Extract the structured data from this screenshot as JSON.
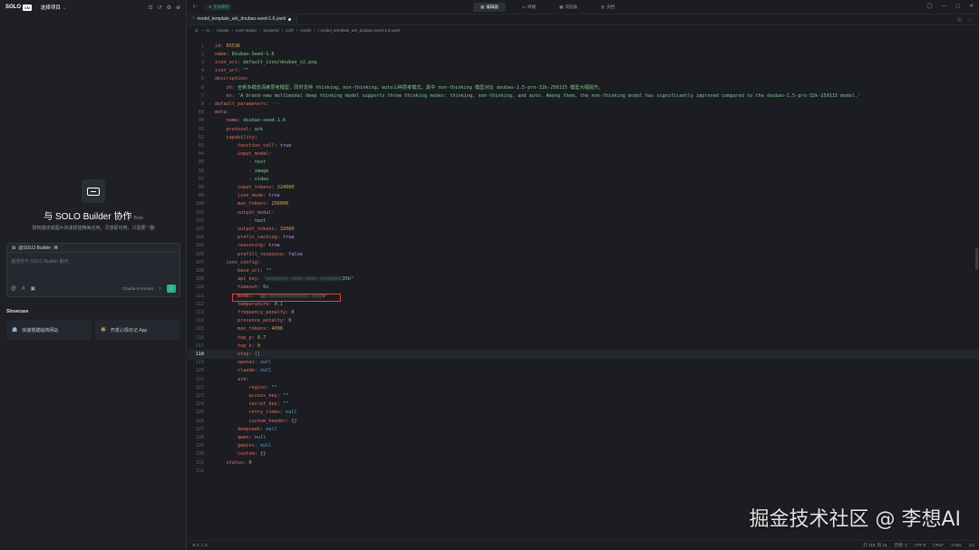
{
  "left_panel": {
    "brand": "SOLO",
    "brand_box": "CN",
    "project_label": "选择项目",
    "hero_title": "与 SOLO Builder 协作",
    "hero_badge": "Beta",
    "hero_subtitle": "按转描述或图片快速搭建精美应用，灵感即可用，只需要一翻",
    "chat_mention": "@SOLO Builder",
    "chat_placeholder": "描述你与 SOLO Builder 聊天",
    "chat_model": "Claude-4-Sonnet",
    "showcase_title": "Showcase",
    "showcase": [
      {
        "label": "快速搭建临商网站"
      },
      {
        "label": "开发心情日记 App"
      }
    ]
  },
  "title_bar": {
    "chip": "灵动模组",
    "tabs": [
      {
        "label": "编辑器",
        "active": true
      },
      {
        "label": "终端",
        "active": false
      },
      {
        "label": "浏览器",
        "active": false
      },
      {
        "label": "文档",
        "active": false
      }
    ]
  },
  "file_tab": {
    "name": "model_template_ark_doubao-seed-1.6.yaml"
  },
  "breadcrumb": [
    "D:",
    "AI",
    "Aicode",
    "coze-studio",
    "backend",
    "conf",
    "model",
    "! model_template_ark_doubao-seed-1.6.yaml"
  ],
  "code_lines": [
    {
      "n": "1",
      "i": 0,
      "parts": [
        [
          "k",
          "id"
        ],
        [
          "p",
          ": "
        ],
        [
          "n",
          "65536"
        ]
      ]
    },
    {
      "n": "2",
      "i": 0,
      "parts": [
        [
          "k",
          "name"
        ],
        [
          "p",
          ": "
        ],
        [
          "s",
          "Doubao-Seed-1.6"
        ]
      ]
    },
    {
      "n": "3",
      "i": 0,
      "parts": [
        [
          "k",
          "icon_uri"
        ],
        [
          "p",
          ": "
        ],
        [
          "s",
          "default_icon/doubao_v2.png"
        ]
      ]
    },
    {
      "n": "4",
      "i": 0,
      "parts": [
        [
          "k",
          "icon_url"
        ],
        [
          "p",
          ": "
        ],
        [
          "s",
          "\"\""
        ]
      ]
    },
    {
      "n": "5",
      "i": 0,
      "parts": [
        [
          "k",
          "description"
        ],
        [
          "p",
          ":"
        ]
      ]
    },
    {
      "n": "6",
      "i": 1,
      "parts": [
        [
          "k",
          "zh"
        ],
        [
          "p",
          ": "
        ],
        [
          "s",
          "全新多模态深度思考模型，同时支持 thinking、non-thinking、auto三种思考模式。其中 non-thinking 模型对比 doubao-1.5-pro-32k-250115 模型大幅提升。"
        ]
      ]
    },
    {
      "n": "7",
      "i": 1,
      "parts": [
        [
          "k",
          "en"
        ],
        [
          "p",
          ": "
        ],
        [
          "s",
          "'A brand-new multimodal deep thinking model supports three thinking modes: thinking, non-thinking, and auto. Among them, the non-thinking model has significantly improved compared to the doubao-1.5-pro-32k-250115 model.'"
        ]
      ]
    },
    {
      "n": "8",
      "i": 0,
      "fold": true,
      "parts": [
        [
          "k",
          "default_parameters"
        ],
        [
          "p",
          ": ···"
        ]
      ]
    },
    {
      "n": "89",
      "i": 0,
      "parts": [
        [
          "k",
          "meta"
        ],
        [
          "p",
          ":"
        ]
      ]
    },
    {
      "n": "90",
      "i": 1,
      "parts": [
        [
          "k",
          "name"
        ],
        [
          "p",
          ": "
        ],
        [
          "s",
          "doubao-seed-1.6"
        ]
      ]
    },
    {
      "n": "91",
      "i": 1,
      "parts": [
        [
          "k",
          "protocol"
        ],
        [
          "p",
          ": "
        ],
        [
          "s",
          "ark"
        ]
      ]
    },
    {
      "n": "92",
      "i": 1,
      "parts": [
        [
          "k",
          "capability"
        ],
        [
          "p",
          ":"
        ]
      ]
    },
    {
      "n": "93",
      "i": 2,
      "parts": [
        [
          "k",
          "function_call"
        ],
        [
          "p",
          ": "
        ],
        [
          "b",
          "true"
        ]
      ]
    },
    {
      "n": "94",
      "i": 2,
      "parts": [
        [
          "k",
          "input_modal"
        ],
        [
          "p",
          ":"
        ]
      ]
    },
    {
      "n": "95",
      "i": 3,
      "parts": [
        [
          "p",
          "- "
        ],
        [
          "s",
          "text"
        ]
      ]
    },
    {
      "n": "96",
      "i": 3,
      "parts": [
        [
          "p",
          "- "
        ],
        [
          "s",
          "image"
        ]
      ]
    },
    {
      "n": "97",
      "i": 3,
      "parts": [
        [
          "p",
          "- "
        ],
        [
          "s",
          "video"
        ]
      ]
    },
    {
      "n": "98",
      "i": 2,
      "parts": [
        [
          "k",
          "input_tokens"
        ],
        [
          "p",
          ": "
        ],
        [
          "n",
          "224000"
        ]
      ]
    },
    {
      "n": "99",
      "i": 2,
      "parts": [
        [
          "k",
          "json_mode"
        ],
        [
          "p",
          ": "
        ],
        [
          "b",
          "true"
        ]
      ]
    },
    {
      "n": "100",
      "i": 2,
      "parts": [
        [
          "k",
          "max_tokens"
        ],
        [
          "p",
          ": "
        ],
        [
          "n",
          "256000"
        ]
      ]
    },
    {
      "n": "101",
      "i": 2,
      "parts": [
        [
          "k",
          "output_modal"
        ],
        [
          "p",
          ":"
        ]
      ]
    },
    {
      "n": "102",
      "i": 3,
      "parts": [
        [
          "p",
          "- "
        ],
        [
          "s",
          "text"
        ]
      ]
    },
    {
      "n": "103",
      "i": 2,
      "parts": [
        [
          "k",
          "output_tokens"
        ],
        [
          "p",
          ": "
        ],
        [
          "n",
          "32000"
        ]
      ]
    },
    {
      "n": "104",
      "i": 2,
      "parts": [
        [
          "k",
          "prefix_caching"
        ],
        [
          "p",
          ": "
        ],
        [
          "b",
          "true"
        ]
      ]
    },
    {
      "n": "105",
      "i": 2,
      "parts": [
        [
          "k",
          "reasoning"
        ],
        [
          "p",
          ": "
        ],
        [
          "b",
          "true"
        ]
      ]
    },
    {
      "n": "106",
      "i": 2,
      "parts": [
        [
          "k",
          "prefill_response"
        ],
        [
          "p",
          ": "
        ],
        [
          "b",
          "false"
        ]
      ]
    },
    {
      "n": "107",
      "i": 1,
      "parts": [
        [
          "k",
          "conn_config"
        ],
        [
          "p",
          ":"
        ]
      ]
    },
    {
      "n": "108",
      "i": 2,
      "parts": [
        [
          "k",
          "base_url"
        ],
        [
          "p",
          ": "
        ],
        [
          "s",
          "\"\""
        ]
      ]
    },
    {
      "n": "109",
      "i": 2,
      "parts": [
        [
          "k",
          "api_key"
        ],
        [
          "p",
          ": "
        ],
        [
          "blur",
          "\"xxxxxxxx-xxxx-xxxx-xxxxxxxx"
        ],
        [
          "s",
          "35b\""
        ]
      ]
    },
    {
      "n": "110",
      "i": 2,
      "parts": [
        [
          "k",
          "timeout"
        ],
        [
          "p",
          ": "
        ],
        [
          "s",
          "0s"
        ]
      ]
    },
    {
      "n": "111",
      "i": 2,
      "parts": [
        [
          "k",
          "model"
        ],
        [
          "p",
          ": "
        ],
        [
          "blur",
          "\"ep-xxxxxxxxxxxxxx-xxxx"
        ],
        [
          "s",
          "v\""
        ]
      ]
    },
    {
      "n": "112",
      "i": 2,
      "parts": [
        [
          "k",
          "temperature"
        ],
        [
          "p",
          ": "
        ],
        [
          "n",
          "0.1"
        ]
      ]
    },
    {
      "n": "113",
      "i": 2,
      "parts": [
        [
          "k",
          "frequency_penalty"
        ],
        [
          "p",
          ": "
        ],
        [
          "n",
          "0"
        ]
      ]
    },
    {
      "n": "114",
      "i": 2,
      "parts": [
        [
          "k",
          "presence_penalty"
        ],
        [
          "p",
          ": "
        ],
        [
          "n",
          "0"
        ]
      ]
    },
    {
      "n": "115",
      "i": 2,
      "parts": [
        [
          "k",
          "max_tokens"
        ],
        [
          "p",
          ": "
        ],
        [
          "n",
          "4096"
        ]
      ]
    },
    {
      "n": "116",
      "i": 2,
      "parts": [
        [
          "k",
          "top_p"
        ],
        [
          "p",
          ": "
        ],
        [
          "n",
          "0.7"
        ]
      ]
    },
    {
      "n": "117",
      "i": 2,
      "parts": [
        [
          "k",
          "top_k"
        ],
        [
          "p",
          ": "
        ],
        [
          "n",
          "0"
        ]
      ]
    },
    {
      "n": "118",
      "i": 2,
      "hl": true,
      "parts": [
        [
          "k",
          "stop"
        ],
        [
          "p",
          ": "
        ],
        [
          "p",
          "[]"
        ]
      ]
    },
    {
      "n": "119",
      "i": 2,
      "parts": [
        [
          "k",
          "openai"
        ],
        [
          "p",
          ": "
        ],
        [
          "nul",
          "null"
        ]
      ]
    },
    {
      "n": "120",
      "i": 2,
      "parts": [
        [
          "k",
          "claude"
        ],
        [
          "p",
          ": "
        ],
        [
          "nul",
          "null"
        ]
      ]
    },
    {
      "n": "121",
      "i": 2,
      "parts": [
        [
          "k",
          "ark"
        ],
        [
          "p",
          ":"
        ]
      ]
    },
    {
      "n": "122",
      "i": 3,
      "parts": [
        [
          "k",
          "region"
        ],
        [
          "p",
          ": "
        ],
        [
          "s",
          "\"\""
        ]
      ]
    },
    {
      "n": "123",
      "i": 3,
      "parts": [
        [
          "k",
          "access_key"
        ],
        [
          "p",
          ": "
        ],
        [
          "s",
          "\"\""
        ]
      ]
    },
    {
      "n": "124",
      "i": 3,
      "parts": [
        [
          "k",
          "secret_key"
        ],
        [
          "p",
          ": "
        ],
        [
          "s",
          "\"\""
        ]
      ]
    },
    {
      "n": "125",
      "i": 3,
      "parts": [
        [
          "k",
          "retry_times"
        ],
        [
          "p",
          ": "
        ],
        [
          "nul",
          "null"
        ]
      ]
    },
    {
      "n": "126",
      "i": 3,
      "parts": [
        [
          "k",
          "custom_header"
        ],
        [
          "p",
          ": "
        ],
        [
          "n",
          "{}"
        ]
      ]
    },
    {
      "n": "127",
      "i": 2,
      "parts": [
        [
          "k",
          "deepseek"
        ],
        [
          "p",
          ": "
        ],
        [
          "nul",
          "null"
        ]
      ]
    },
    {
      "n": "128",
      "i": 2,
      "parts": [
        [
          "k",
          "qwen"
        ],
        [
          "p",
          ": "
        ],
        [
          "nul",
          "null"
        ]
      ]
    },
    {
      "n": "129",
      "i": 2,
      "parts": [
        [
          "k",
          "gemini"
        ],
        [
          "p",
          ": "
        ],
        [
          "nul",
          "null"
        ]
      ]
    },
    {
      "n": "130",
      "i": 2,
      "parts": [
        [
          "k",
          "custom"
        ],
        [
          "p",
          ": "
        ],
        [
          "n",
          "{}"
        ]
      ]
    },
    {
      "n": "131",
      "i": 1,
      "parts": [
        [
          "k",
          "status"
        ],
        [
          "p",
          ": "
        ],
        [
          "n",
          "0"
        ]
      ]
    },
    {
      "n": "132",
      "i": 0,
      "parts": []
    }
  ],
  "status_bar": {
    "left": "⊗ 0 ⚠ 0",
    "right": [
      "行 118, 列 15",
      "空格: 2",
      "UTF-8",
      "CRLF",
      "YAML",
      "Go"
    ]
  },
  "watermark": "掘金技术社区 @ 李想AI",
  "colors": {
    "accent": "#2db38a",
    "highlight_box": "#e0463a"
  }
}
